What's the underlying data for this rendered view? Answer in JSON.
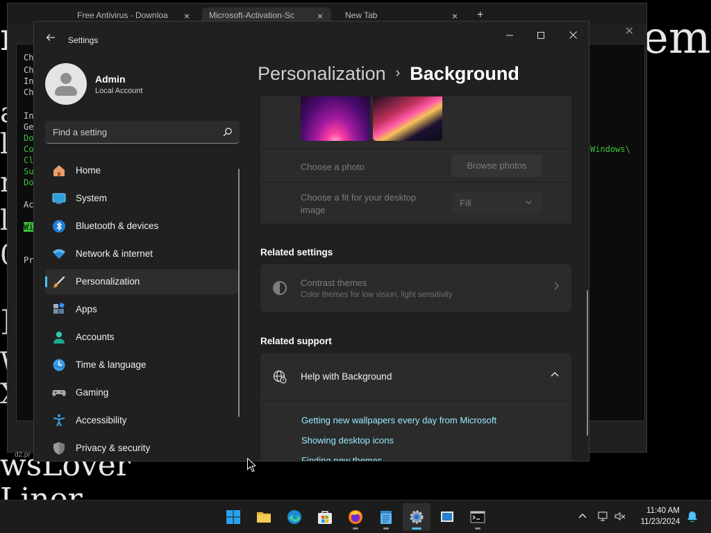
{
  "desktop": {
    "bg_text_right": "ems",
    "bg_text_left_top": "n",
    "bg_text_bottom_1": "wsLover",
    "bg_text_bottom_2": "Liner",
    "left_glyphs": [
      "a",
      "l",
      "r",
      "l",
      "0",
      "]",
      "W",
      "X"
    ]
  },
  "browser": {
    "tabs": [
      {
        "label": "Free Antivirus - Downloa",
        "active": false
      },
      {
        "label": "Microsoft-Activation-Sc",
        "active": true
      },
      {
        "label": "New Tab",
        "active": false
      }
    ],
    "tab_close": "×",
    "new_tab": "+",
    "terminal": {
      "lines": [
        "Ch",
        "Ch",
        "In",
        "Ch",
        "",
        "In",
        "Ge",
        "Do",
        "Co",
        "Cl",
        "Su",
        "Do",
        "",
        "Ac",
        "",
        "Wi",
        "",
        "Pr"
      ],
      "right_text": "Windows\\",
      "status": "d2.pr"
    }
  },
  "settings": {
    "app_title": "Settings",
    "profile": {
      "name": "Admin",
      "account_type": "Local Account"
    },
    "search": {
      "placeholder": "Find a setting"
    },
    "nav": [
      {
        "label": "Home",
        "icon": "home-icon"
      },
      {
        "label": "System",
        "icon": "system-icon"
      },
      {
        "label": "Bluetooth & devices",
        "icon": "bluetooth-icon"
      },
      {
        "label": "Network & internet",
        "icon": "network-icon"
      },
      {
        "label": "Personalization",
        "icon": "personalization-icon",
        "selected": true
      },
      {
        "label": "Apps",
        "icon": "apps-icon"
      },
      {
        "label": "Accounts",
        "icon": "accounts-icon"
      },
      {
        "label": "Time & language",
        "icon": "time-language-icon"
      },
      {
        "label": "Gaming",
        "icon": "gaming-icon"
      },
      {
        "label": "Accessibility",
        "icon": "accessibility-icon"
      },
      {
        "label": "Privacy & security",
        "icon": "privacy-security-icon"
      }
    ],
    "breadcrumb": {
      "parent": "Personalization",
      "separator": "›",
      "current": "Background"
    },
    "background": {
      "choose_photo_label": "Choose a photo",
      "browse_button": "Browse photos",
      "fit_label_line1": "Choose a fit for your desktop",
      "fit_label_line2": "image",
      "fit_value": "Fill"
    },
    "related_settings": {
      "heading": "Related settings",
      "contrast_title": "Contrast themes",
      "contrast_subtitle": "Color themes for low vision, light sensitivity"
    },
    "related_support": {
      "heading": "Related support",
      "help_title": "Help with Background",
      "links": [
        "Getting new wallpapers every day from Microsoft",
        "Showing desktop icons",
        "Finding new themes"
      ]
    }
  },
  "taskbar": {
    "apps": [
      "start-icon",
      "file-explorer-icon",
      "edge-icon",
      "store-icon",
      "firefox-icon",
      "notepad-icon",
      "settings-icon",
      "task-view-icon",
      "terminal-icon"
    ],
    "active_app": "settings-icon",
    "time": "11:40 AM",
    "date": "11/23/2024"
  },
  "colors": {
    "accent": "#4cc2ff",
    "link": "#99ebff",
    "window_bg": "#202020",
    "card_bg": "#2b2b2b"
  }
}
